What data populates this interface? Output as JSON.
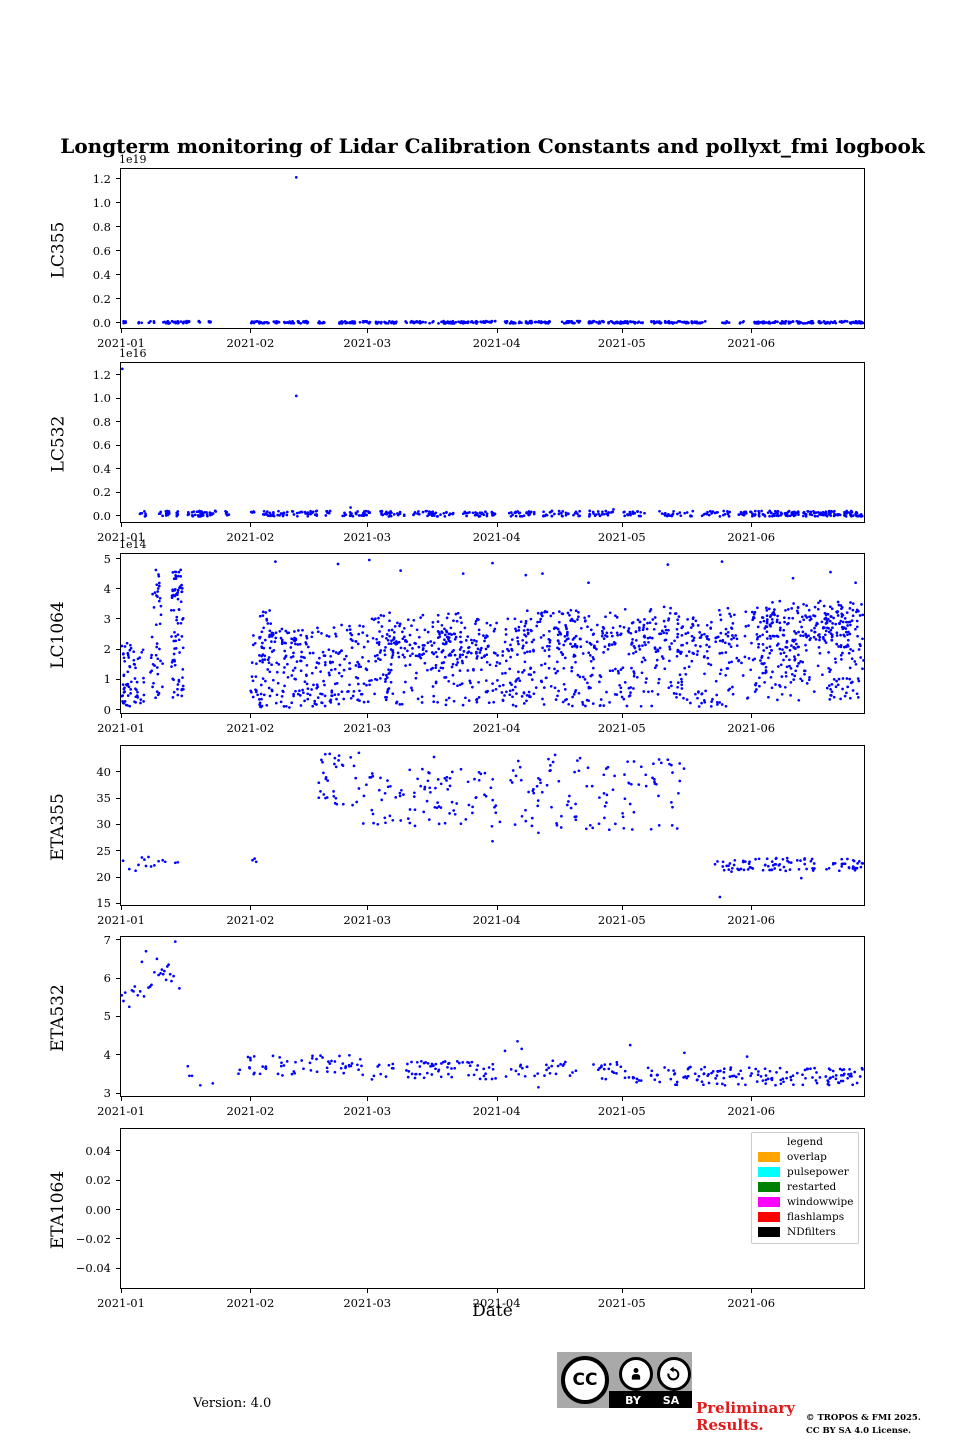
{
  "title": "Longterm monitoring of Lidar Calibration Constants and pollyxt_fmi logbook",
  "xlabel": "Date",
  "footer": {
    "version": "Version: 4.0",
    "preliminary_line1": "Preliminary",
    "preliminary_line2": "Results.",
    "copyright_line1": "© TROPOS & FMI 2025.",
    "copyright_line2": "CC BY SA 4.0 License.",
    "cc_badge": {
      "cc": "CC",
      "by": "BY",
      "sa": "SA"
    }
  },
  "legend": {
    "title": "legend",
    "entries": [
      {
        "label": "overlap",
        "color": "#ffa500"
      },
      {
        "label": "pulsepower",
        "color": "#00ffff"
      },
      {
        "label": "restarted",
        "color": "#008000"
      },
      {
        "label": "windowwipe",
        "color": "#ff00ff"
      },
      {
        "label": "flashlamps",
        "color": "#ff0000"
      },
      {
        "label": "NDfilters",
        "color": "#000000"
      }
    ]
  },
  "chart_data": {
    "type": "scatter",
    "marker_color": "#0000ff",
    "seed": 20,
    "x_axis": {
      "tick_days": [
        0,
        31,
        59,
        90,
        120,
        151
      ],
      "tick_labels": [
        "2021-01",
        "2021-02",
        "2021-03",
        "2021-04",
        "2021-05",
        "2021-06"
      ],
      "xmax_days": 178.5
    },
    "panels": [
      {
        "ylabel": "LC355",
        "offset": "1e19",
        "ylim": [
          -0.06,
          1.28
        ],
        "ytick_values": [
          0.0,
          0.2,
          0.4,
          0.6,
          0.8,
          1.0,
          1.2
        ],
        "ytick_labels": [
          "0.0",
          "0.2",
          "0.4",
          "0.6",
          "0.8",
          "1.0",
          "1.2"
        ],
        "strips": [
          [
            0,
            1.5,
            5
          ],
          [
            4,
            5,
            4
          ],
          [
            6.5,
            8,
            5
          ],
          [
            10,
            17,
            34
          ],
          [
            18.5,
            19.2,
            3
          ],
          [
            21,
            22.5,
            5
          ],
          [
            31,
            38,
            32
          ],
          [
            39,
            45,
            28
          ],
          [
            47,
            49,
            9
          ],
          [
            52,
            60,
            36
          ],
          [
            61,
            66,
            24
          ],
          [
            68,
            75,
            22
          ],
          [
            76,
            90,
            62
          ],
          [
            92,
            96,
            16
          ],
          [
            97,
            104,
            30
          ],
          [
            105,
            110,
            22
          ],
          [
            112,
            125,
            58
          ],
          [
            127,
            140,
            54
          ],
          [
            144,
            146,
            7
          ],
          [
            148,
            149.5,
            4
          ],
          [
            151,
            166,
            68
          ],
          [
            167,
            178,
            52
          ]
        ],
        "strip_y": 0.004,
        "strip_jitter": 0.01,
        "blobs": [],
        "points": [
          [
            42,
            1.21
          ]
        ]
      },
      {
        "ylabel": "LC532",
        "offset": "1e16",
        "ylim": [
          -0.07,
          1.3
        ],
        "ytick_values": [
          0.0,
          0.2,
          0.4,
          0.6,
          0.8,
          1.0,
          1.2
        ],
        "ytick_labels": [
          "0.0",
          "0.2",
          "0.4",
          "0.6",
          "0.8",
          "1.0",
          "1.2"
        ],
        "strips": [
          [
            4.5,
            6,
            7
          ],
          [
            9,
            12,
            16
          ],
          [
            13,
            14.2,
            6
          ],
          [
            16,
            23,
            34
          ],
          [
            25,
            26,
            5
          ],
          [
            31,
            32,
            4
          ],
          [
            34,
            40,
            26
          ],
          [
            41,
            47,
            24
          ],
          [
            49,
            50.5,
            6
          ],
          [
            53,
            60,
            30
          ],
          [
            62,
            68,
            24
          ],
          [
            70,
            80,
            34
          ],
          [
            82,
            90,
            30
          ],
          [
            93,
            100,
            26
          ],
          [
            101,
            110,
            30
          ],
          [
            112,
            118,
            24
          ],
          [
            120,
            126,
            20
          ],
          [
            129,
            137,
            24
          ],
          [
            139,
            146,
            22
          ],
          [
            148,
            160,
            60
          ],
          [
            160,
            178,
            95
          ]
        ],
        "strip_y": 0.018,
        "strip_jitter": 0.024,
        "blobs": [],
        "points": [
          [
            0.3,
            1.25
          ],
          [
            42,
            1.02
          ],
          [
            55,
            0.07
          ],
          [
            118,
            0.055
          ]
        ]
      },
      {
        "ylabel": "LC1064",
        "offset": "1e14",
        "ylim": [
          -0.18,
          5.15
        ],
        "ytick_values": [
          0,
          1,
          2,
          3,
          4,
          5
        ],
        "ytick_labels": [
          "0",
          "1",
          "2",
          "3",
          "4",
          "5"
        ],
        "strips": [],
        "strip_y": 0,
        "strip_jitter": 0,
        "blobs": [
          [
            0,
            2.5,
            0.05,
            2.2,
            40
          ],
          [
            3,
            5.5,
            0.2,
            2.0,
            25
          ],
          [
            7,
            10,
            0.3,
            3.9,
            32
          ],
          [
            8,
            9.3,
            3.4,
            4.7,
            10
          ],
          [
            12,
            15,
            0.3,
            4.0,
            55
          ],
          [
            12.3,
            14.7,
            3.7,
            4.65,
            26
          ],
          [
            31,
            45,
            0.05,
            2.7,
            150
          ],
          [
            33,
            36.5,
            1.4,
            3.3,
            22
          ],
          [
            45,
            60,
            0.1,
            2.9,
            130
          ],
          [
            60,
            90,
            0.1,
            3.25,
            240
          ],
          [
            63,
            88,
            1.7,
            2.6,
            85
          ],
          [
            90,
            120,
            0.1,
            3.3,
            235
          ],
          [
            95,
            118,
            1.8,
            2.8,
            75
          ],
          [
            120,
            150,
            0.1,
            3.4,
            205
          ],
          [
            122,
            148,
            1.9,
            3.0,
            72
          ],
          [
            150,
            178,
            0.3,
            3.6,
            265
          ],
          [
            152,
            175,
            2.0,
            3.35,
            125
          ]
        ],
        "points": [
          [
            37,
            4.9
          ],
          [
            52,
            4.82
          ],
          [
            59.5,
            4.95
          ],
          [
            67,
            4.6
          ],
          [
            82,
            4.5
          ],
          [
            89,
            4.85
          ],
          [
            97,
            4.45
          ],
          [
            101,
            4.5
          ],
          [
            112,
            4.2
          ],
          [
            131,
            4.8
          ],
          [
            144,
            4.9
          ],
          [
            161,
            4.35
          ],
          [
            170,
            4.55
          ],
          [
            176,
            4.2
          ]
        ]
      },
      {
        "ylabel": "ETA355",
        "offset": "",
        "ylim": [
          14.3,
          44.9
        ],
        "ytick_values": [
          15,
          20,
          25,
          30,
          35,
          40
        ],
        "ytick_labels": [
          "15",
          "20",
          "25",
          "30",
          "35",
          "40"
        ],
        "strips": [],
        "strip_y": 0,
        "strip_jitter": 0,
        "blobs": [
          [
            47,
            58,
            33,
            43.5,
            32
          ],
          [
            58,
            95,
            29.5,
            41,
            100
          ],
          [
            95,
            135,
            29,
            42.5,
            100
          ],
          [
            142,
            178,
            21,
            23.6,
            95
          ]
        ],
        "points": [
          [
            0.5,
            23.1
          ],
          [
            2,
            21.5
          ],
          [
            3.5,
            21.2
          ],
          [
            4.2,
            22.3
          ],
          [
            5,
            23.7
          ],
          [
            5.6,
            23.3
          ],
          [
            6,
            22.1
          ],
          [
            6.6,
            23.8
          ],
          [
            7.2,
            22.0
          ],
          [
            8,
            22.2
          ],
          [
            9,
            23.0
          ],
          [
            10,
            23.2
          ],
          [
            10.6,
            22.9
          ],
          [
            13,
            22.7
          ],
          [
            13.6,
            22.8
          ],
          [
            31.5,
            23.2
          ],
          [
            32,
            23.5
          ],
          [
            32.4,
            22.9
          ],
          [
            89,
            26.8
          ],
          [
            100,
            28.4
          ],
          [
            117,
            29.0
          ],
          [
            143.5,
            16.2
          ],
          [
            163,
            19.8
          ],
          [
            50,
            43.4
          ],
          [
            57,
            43.6
          ],
          [
            75,
            42.8
          ],
          [
            104,
            43.2
          ],
          [
            110,
            42.6
          ],
          [
            131,
            42.3
          ]
        ]
      },
      {
        "ylabel": "ETA532",
        "offset": "",
        "ylim": [
          2.87,
          7.07
        ],
        "ytick_values": [
          3,
          4,
          5,
          6,
          7
        ],
        "ytick_labels": [
          "3",
          "4",
          "5",
          "6",
          "7"
        ],
        "strips": [],
        "strip_y": 0,
        "strip_jitter": 0,
        "blobs": [
          [
            27,
            60,
            3.45,
            4.0,
            60
          ],
          [
            60,
            120,
            3.35,
            3.85,
            115
          ],
          [
            120,
            178,
            3.2,
            3.68,
            155
          ]
        ],
        "points": [
          [
            0.2,
            5.55
          ],
          [
            0.6,
            5.4
          ],
          [
            1,
            5.62
          ],
          [
            2,
            5.25
          ],
          [
            2.6,
            5.68
          ],
          [
            3,
            5.65
          ],
          [
            3.3,
            5.78
          ],
          [
            4,
            5.55
          ],
          [
            4.6,
            5.65
          ],
          [
            5,
            6.42
          ],
          [
            5.5,
            5.52
          ],
          [
            6,
            6.7
          ],
          [
            6.6,
            5.75
          ],
          [
            7,
            5.78
          ],
          [
            7.3,
            5.82
          ],
          [
            8,
            6.15
          ],
          [
            8.6,
            6.5
          ],
          [
            9,
            6.08
          ],
          [
            9.5,
            6.12
          ],
          [
            9.8,
            6.22
          ],
          [
            10.1,
            6.1
          ],
          [
            10.4,
            6.18
          ],
          [
            10.8,
            5.95
          ],
          [
            11.1,
            6.3
          ],
          [
            11.4,
            6.35
          ],
          [
            11.8,
            6.1
          ],
          [
            12.1,
            5.92
          ],
          [
            12.6,
            6.05
          ],
          [
            13,
            6.95
          ],
          [
            14,
            5.73
          ],
          [
            16,
            3.7
          ],
          [
            16.4,
            3.45
          ],
          [
            17,
            3.45
          ],
          [
            19,
            3.2
          ],
          [
            22,
            3.25
          ],
          [
            92,
            4.1
          ],
          [
            95,
            4.35
          ],
          [
            96,
            4.15
          ],
          [
            100,
            3.15
          ],
          [
            122,
            4.25
          ],
          [
            135,
            4.05
          ],
          [
            150,
            3.95
          ]
        ]
      },
      {
        "ylabel": "ETA1064",
        "offset": "",
        "ylim": [
          -0.055,
          0.055
        ],
        "ytick_values": [
          0.04,
          0.02,
          0.0,
          -0.02,
          -0.04
        ],
        "ytick_labels": [
          "0.04",
          "0.02",
          "0.00",
          "−0.02",
          "−0.04"
        ],
        "strips": [],
        "strip_y": 0,
        "strip_jitter": 0,
        "blobs": [],
        "points": []
      }
    ]
  }
}
